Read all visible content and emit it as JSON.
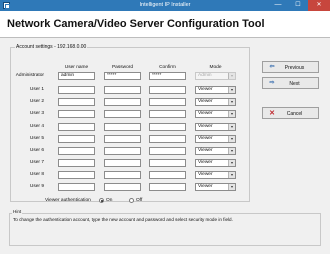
{
  "window": {
    "title": "Intelligent IP Installer",
    "minimize": "—",
    "maximize": "☐",
    "close": "✕"
  },
  "header": {
    "title": "Network Camera/Video Server Configuration Tool"
  },
  "account_group": {
    "legend": "Account settings - 192.168.0.00"
  },
  "columns": {
    "username": "User name",
    "password": "Password",
    "confirm": "Confirm",
    "mode": "Mode"
  },
  "rows": [
    {
      "label": "Administrator",
      "username": "admin",
      "password": "*****",
      "confirm": "*****",
      "mode": "Admin",
      "mode_disabled": true
    },
    {
      "label": "User 1",
      "username": "",
      "password": "",
      "confirm": "",
      "mode": "Viewer"
    },
    {
      "label": "User 2",
      "username": "",
      "password": "",
      "confirm": "",
      "mode": "Viewer"
    },
    {
      "label": "User 3",
      "username": "",
      "password": "",
      "confirm": "",
      "mode": "Viewer"
    },
    {
      "label": "User 4",
      "username": "",
      "password": "",
      "confirm": "",
      "mode": "Viewer"
    },
    {
      "label": "User 5",
      "username": "",
      "password": "",
      "confirm": "",
      "mode": "Viewer"
    },
    {
      "label": "User 6",
      "username": "",
      "password": "",
      "confirm": "",
      "mode": "Viewer"
    },
    {
      "label": "User 7",
      "username": "",
      "password": "",
      "confirm": "",
      "mode": "Viewer"
    },
    {
      "label": "User 8",
      "username": "",
      "password": "",
      "confirm": "",
      "mode": "Viewer"
    },
    {
      "label": "User 9",
      "username": "",
      "password": "",
      "confirm": "",
      "mode": "Viewer"
    }
  ],
  "viewer_auth": {
    "label": "Viewer authentication",
    "on": "On",
    "off": "Off",
    "selected": "on"
  },
  "buttons": {
    "previous": "Previous",
    "next": "Next",
    "cancel": "Cancel"
  },
  "hint": {
    "legend": "Hint",
    "text": "To change the authentication account, type the new account and password and select security mode in field."
  },
  "icons": {
    "app": "app-window-icon",
    "previous": "arrow-left-icon",
    "next": "arrow-right-icon",
    "cancel": "cancel-x-icon",
    "dropdown": "chevron-down-icon"
  },
  "colors": {
    "titlebar": "#2f79b8",
    "close": "#c7463d",
    "accent": "#3a6fb0"
  }
}
